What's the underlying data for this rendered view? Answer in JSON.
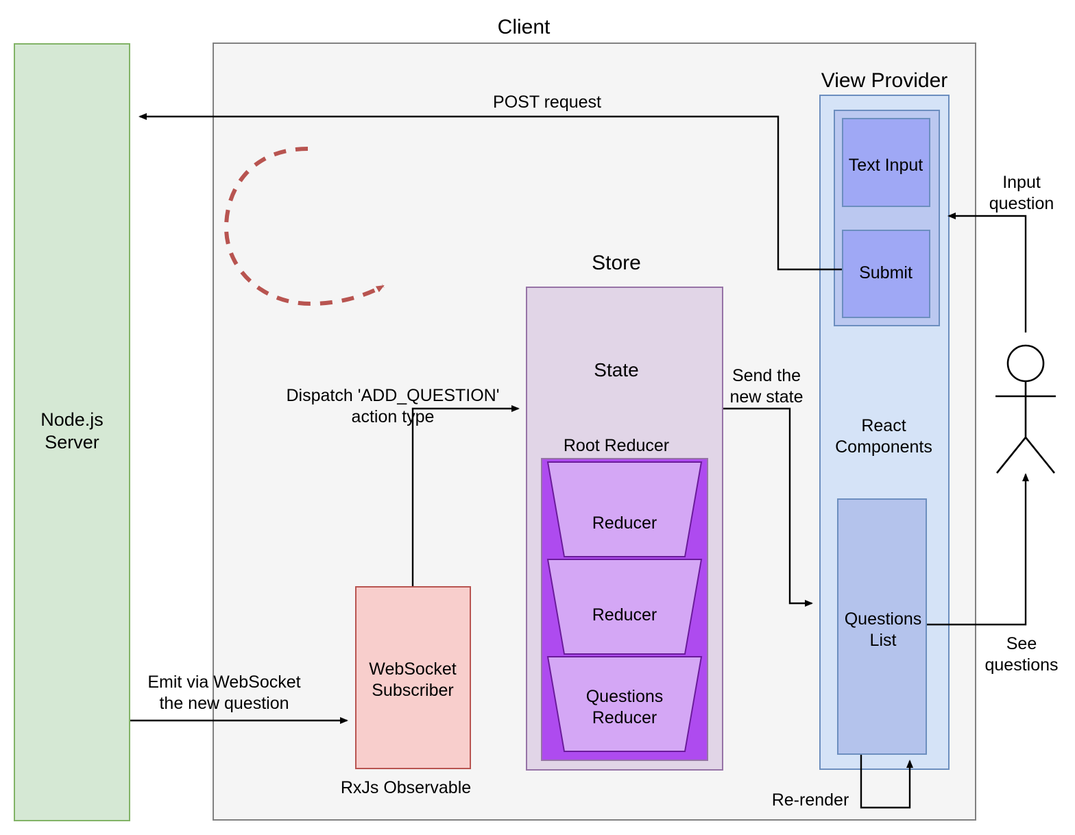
{
  "diagram": {
    "title": "Client",
    "nodes": {
      "client": "Client",
      "node_server": "Node.js\nServer",
      "view_provider": "View Provider",
      "store": "Store",
      "state": "State",
      "root_reducer": "Root Reducer",
      "reducer_1": "Reducer",
      "reducer_2": "Reducer",
      "reducer_3": "Questions\nReducer",
      "websocket_subscriber": "WebSocket\nSubscriber",
      "rxjs_observable": "RxJs Observable",
      "text_input": "Text Input",
      "submit": "Submit",
      "react_components": "React\nComponents",
      "questions_list": "Questions\nList"
    },
    "edges": {
      "post_request": "POST request",
      "dispatch": "Dispatch 'ADD_QUESTION'\naction type",
      "emit_websocket": "Emit via WebSocket\nthe new question",
      "send_new_state": "Send the\nnew state",
      "input_question": "Input\nquestion",
      "see_questions": "See\nquestions",
      "re_render": "Re-render"
    },
    "colors": {
      "client_fill": "#f5f5f5",
      "client_stroke": "#808080",
      "server_fill": "#d5e8d4",
      "server_stroke": "#82b366",
      "websocket_fill": "#f8cecc",
      "websocket_stroke": "#b85450",
      "state_fill": "#e1d5e7",
      "state_stroke": "#9673a6",
      "root_reducer_fill": "#ae4bef",
      "reducer_fill": "#d4a7f5",
      "react_fill": "#d5e3f7",
      "react_stroke": "#6c8ebf",
      "form_fill": "#bbc8f0",
      "input_fill": "#9fa8f5",
      "questions_list_fill": "#b4c3ec",
      "loop_arc": "#b85450",
      "edge_stroke": "#000000"
    }
  }
}
